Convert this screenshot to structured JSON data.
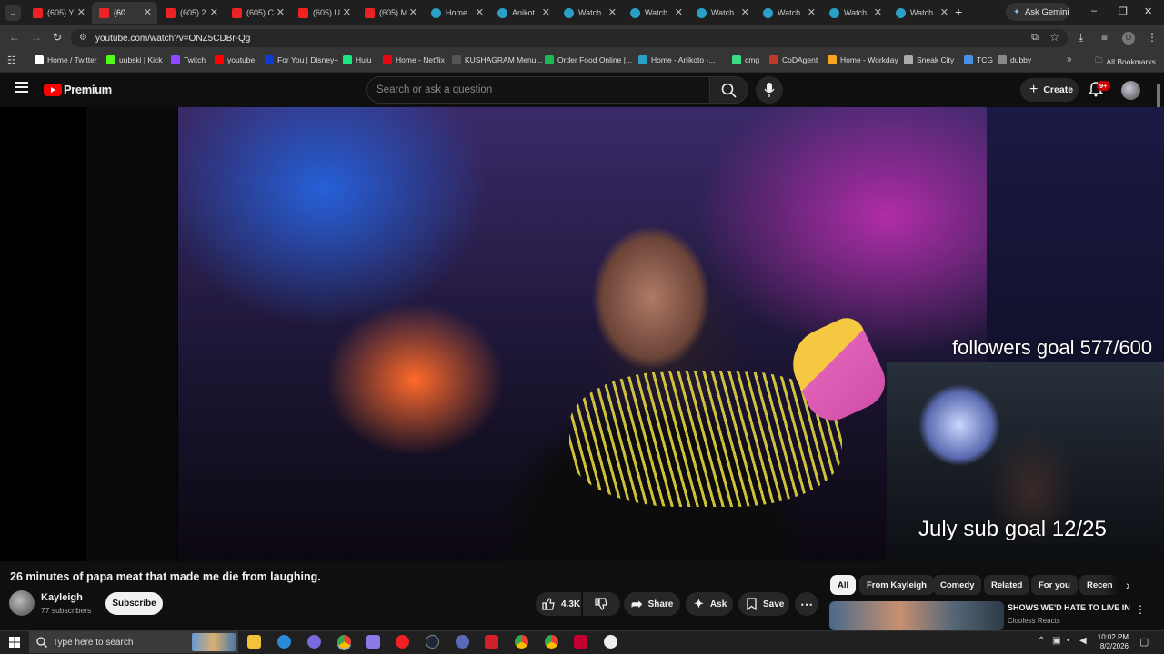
{
  "browser": {
    "tabs": [
      {
        "label": "(605) Y",
        "favicon": "youtube-icon"
      },
      {
        "label": "(60",
        "favicon": "youtube-icon",
        "active": true
      },
      {
        "label": "(605) 2",
        "favicon": "youtube-icon"
      },
      {
        "label": "(605) C",
        "favicon": "youtube-icon"
      },
      {
        "label": "(605) U",
        "favicon": "youtube-icon"
      },
      {
        "label": "(605) M",
        "favicon": "youtube-icon"
      },
      {
        "label": "Home",
        "favicon": "anikoto-icon"
      },
      {
        "label": "Anikot",
        "favicon": "anikoto-icon"
      },
      {
        "label": "Watch",
        "favicon": "anikoto-icon"
      },
      {
        "label": "Watch",
        "favicon": "anikoto-icon"
      },
      {
        "label": "Watch",
        "favicon": "anikoto-icon"
      },
      {
        "label": "Watch",
        "favicon": "anikoto-icon"
      },
      {
        "label": "Watch",
        "favicon": "anikoto-icon"
      },
      {
        "label": "Watch",
        "favicon": "anikoto-icon"
      }
    ],
    "new_tab": "+",
    "ask_gemini": "Ask Gemini",
    "url": "youtube.com/watch?v=ONZ5CDBr-Qg",
    "bookmarks": [
      {
        "label": "Home / Twitter",
        "color": "#ffffff"
      },
      {
        "label": "uubski | Kick",
        "color": "#53fc18"
      },
      {
        "label": "Twitch",
        "color": "#9146ff"
      },
      {
        "label": "youtube",
        "color": "#ff0000"
      },
      {
        "label": "For You | Disney+",
        "color": "#113ccf"
      },
      {
        "label": "Hulu",
        "color": "#1ce783"
      },
      {
        "label": "Home - Netflix",
        "color": "#e50914"
      },
      {
        "label": "KUSHAGRAM Menu...",
        "color": "#555555"
      },
      {
        "label": "Order Food Online |...",
        "color": "#1db954"
      },
      {
        "label": "Home - Anikoto -...",
        "color": "#2aa0c7"
      },
      {
        "label": "cmg",
        "color": "#3ddc84"
      },
      {
        "label": "CoDAgent",
        "color": "#c0392b"
      },
      {
        "label": "Home - Workday",
        "color": "#f5a623"
      },
      {
        "label": "Sneak City",
        "color": "#aaaaaa"
      },
      {
        "label": "TCG",
        "color": "#4a90e2"
      },
      {
        "label": "dubby",
        "color": "#888888"
      }
    ],
    "all_bookmarks": "All Bookmarks",
    "profile_initial": "O"
  },
  "youtube": {
    "logo_text": "Premium",
    "search_placeholder": "Search or ask a question",
    "create_label": "Create",
    "notif_badge": "9+",
    "video": {
      "overlay_followers": "followers goal 577/600",
      "overlay_subs": "July sub goal 12/25"
    },
    "title": "26 minutes of papa meat that made me die from laughing.",
    "channel": "Kayleigh",
    "subscribers": "77 subscribers",
    "subscribe_label": "Subscribe",
    "likes": "4.3K",
    "share_label": "Share",
    "ask_label": "Ask",
    "save_label": "Save",
    "chips": [
      "All",
      "From Kayleigh",
      "Comedy",
      "Related",
      "For you",
      "Recen"
    ],
    "recommendation": {
      "title": "SHOWS WE'D HATE TO LIVE IN",
      "channel": "Clooless Reacts"
    }
  },
  "taskbar": {
    "search_placeholder": "Type here to search",
    "time": "10:02 PM",
    "date": "8/2/2026"
  }
}
